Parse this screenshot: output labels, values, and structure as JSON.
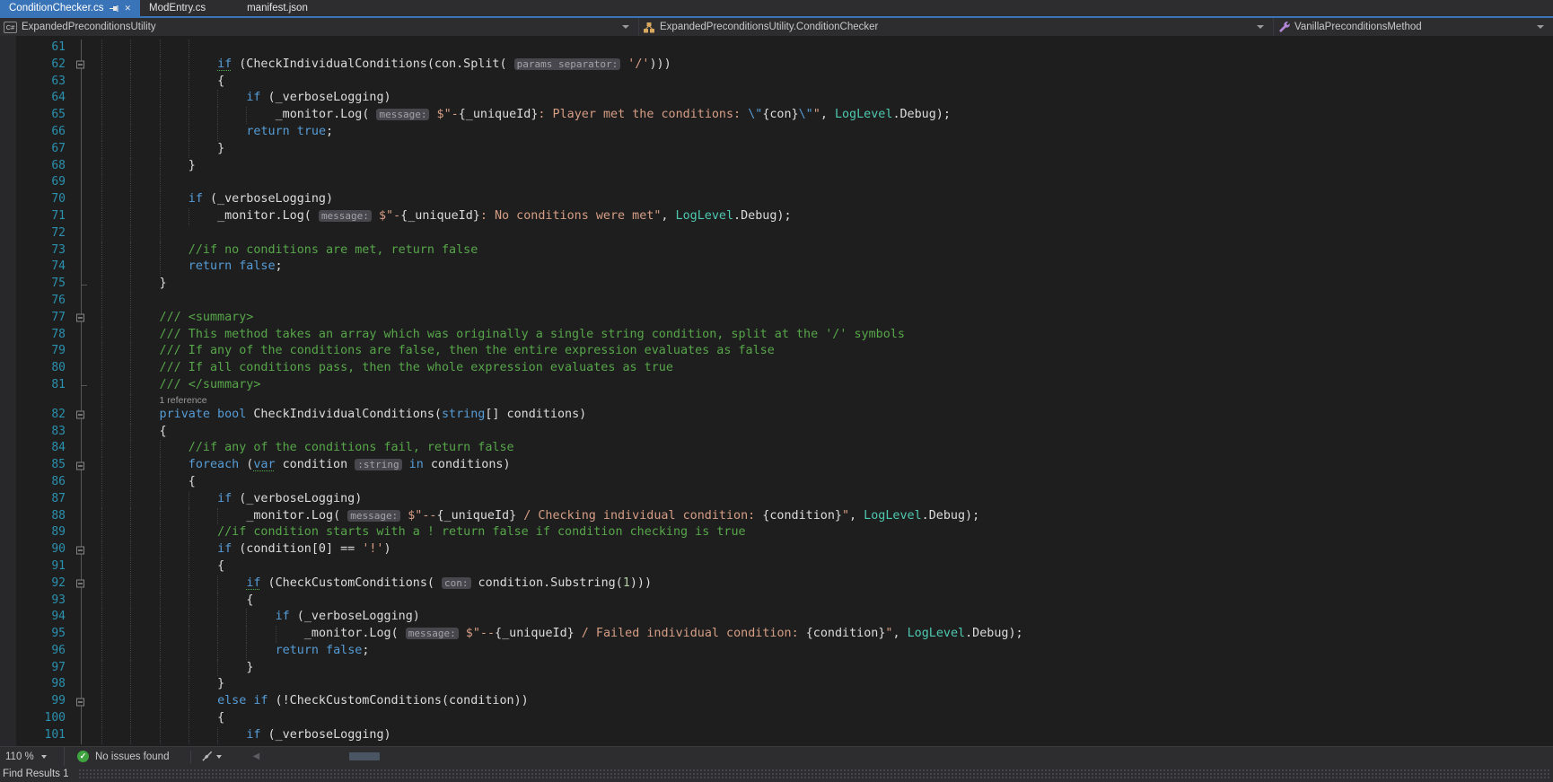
{
  "tabs": [
    {
      "label": "ConditionChecker.cs",
      "active": true
    },
    {
      "label": "ModEntry.cs",
      "active": false
    },
    {
      "label": "manifest.json",
      "active": false
    }
  ],
  "breadcrumb": {
    "project_scope": "ExpandedPreconditionsUtility",
    "type_scope": "ExpandedPreconditionsUtility.ConditionChecker",
    "member_scope": "VanillaPreconditionsMethod"
  },
  "status": {
    "zoom_level": "110 %",
    "issues_text": "No issues found"
  },
  "panel": {
    "title": "Find Results 1"
  },
  "colors": {
    "editor_background": "#1e1e1e",
    "chrome_background": "#2d2d30",
    "active_tab_blue": "#3973b8",
    "keyword_blue": "#569cd6",
    "string_orange": "#d69d85",
    "comment_green": "#57a64a",
    "type_teal": "#4ec9b0",
    "number_green": "#b5cea8",
    "line_number_blue": "#2b91af",
    "status_ok_green": "#3fa33f"
  },
  "editor": {
    "lines": [
      {
        "n": "61",
        "g": 4,
        "ol": "l",
        "seg": []
      },
      {
        "n": "62",
        "g": 4,
        "ol": "b",
        "seg": [
          [
            "kq",
            "if"
          ],
          [
            "p",
            " (CheckIndividualConditions(con.Split( "
          ],
          [
            "ch",
            "params separator:"
          ],
          [
            "s",
            " '/'"
          ],
          [
            "p",
            ")))"
          ]
        ]
      },
      {
        "n": "63",
        "g": 4,
        "ol": "l",
        "seg": [
          [
            "p",
            "{"
          ]
        ]
      },
      {
        "n": "64",
        "g": 5,
        "ol": "l",
        "seg": [
          [
            "k",
            "if"
          ],
          [
            "p",
            " (_verboseLogging)"
          ]
        ]
      },
      {
        "n": "65",
        "g": 6,
        "ol": "l",
        "seg": [
          [
            "p",
            "_monitor.Log( "
          ],
          [
            "ch",
            "message:"
          ],
          [
            "s",
            " $\"-"
          ],
          [
            "p",
            "{_uniqueId}"
          ],
          [
            "s",
            ": Player met the conditions: "
          ],
          [
            "e",
            "\\\""
          ],
          [
            "p",
            "{con}"
          ],
          [
            "e",
            "\\\""
          ],
          [
            "s",
            "\""
          ],
          [
            "p",
            ", "
          ],
          [
            "t",
            "LogLevel"
          ],
          [
            "p",
            ".Debug);"
          ]
        ]
      },
      {
        "n": "66",
        "g": 5,
        "ol": "l",
        "seg": [
          [
            "k",
            "return true"
          ],
          [
            "p",
            ";"
          ]
        ]
      },
      {
        "n": "67",
        "g": 4,
        "ol": "l",
        "seg": [
          [
            "p",
            "}"
          ]
        ]
      },
      {
        "n": "68",
        "g": 3,
        "ol": "l",
        "seg": [
          [
            "p",
            "}"
          ]
        ]
      },
      {
        "n": "69",
        "g": 3,
        "ol": "l",
        "seg": []
      },
      {
        "n": "70",
        "g": 3,
        "ol": "l",
        "seg": [
          [
            "k",
            "if"
          ],
          [
            "p",
            " (_verboseLogging)"
          ]
        ]
      },
      {
        "n": "71",
        "g": 4,
        "ol": "l",
        "seg": [
          [
            "p",
            "_monitor.Log( "
          ],
          [
            "ch",
            "message:"
          ],
          [
            "s",
            " $\"-"
          ],
          [
            "p",
            "{_uniqueId}"
          ],
          [
            "s",
            ": No conditions were met\""
          ],
          [
            "p",
            ", "
          ],
          [
            "t",
            "LogLevel"
          ],
          [
            "p",
            ".Debug);"
          ]
        ]
      },
      {
        "n": "72",
        "g": 3,
        "ol": "l",
        "seg": []
      },
      {
        "n": "73",
        "g": 3,
        "ol": "l",
        "seg": [
          [
            "c",
            "//if no conditions are met, return false"
          ]
        ]
      },
      {
        "n": "74",
        "g": 3,
        "ol": "l",
        "seg": [
          [
            "k",
            "return false"
          ],
          [
            "p",
            ";"
          ]
        ]
      },
      {
        "n": "75",
        "g": 2,
        "ol": "t",
        "seg": [
          [
            "p",
            "}"
          ]
        ]
      },
      {
        "n": "76",
        "g": 2,
        "ol": "l",
        "seg": []
      },
      {
        "n": "77",
        "g": 2,
        "ol": "b",
        "seg": [
          [
            "c",
            "/// <summary>"
          ]
        ]
      },
      {
        "n": "78",
        "g": 2,
        "ol": "l",
        "seg": [
          [
            "c",
            "/// This method takes an array which was originally a single string condition, split at the '/' symbols"
          ]
        ]
      },
      {
        "n": "79",
        "g": 2,
        "ol": "l",
        "seg": [
          [
            "c",
            "/// If any of the conditions are false, then the entire expression evaluates as false"
          ]
        ]
      },
      {
        "n": "80",
        "g": 2,
        "ol": "l",
        "seg": [
          [
            "c",
            "/// If all conditions pass, then the whole expression evaluates as true"
          ]
        ]
      },
      {
        "n": "81",
        "g": 2,
        "ol": "t",
        "seg": [
          [
            "c",
            "/// </summary>"
          ]
        ]
      },
      {
        "n": "",
        "g": 2,
        "ol": "l",
        "lens": "1 reference"
      },
      {
        "n": "82",
        "g": 2,
        "ol": "b",
        "seg": [
          [
            "k",
            "private bool"
          ],
          [
            "p",
            " CheckIndividualConditions("
          ],
          [
            "k",
            "string"
          ],
          [
            "p",
            "[] conditions)"
          ]
        ]
      },
      {
        "n": "83",
        "g": 2,
        "ol": "l",
        "seg": [
          [
            "p",
            "{"
          ]
        ]
      },
      {
        "n": "84",
        "g": 3,
        "ol": "l",
        "seg": [
          [
            "c",
            "//if any of the conditions fail, return false"
          ]
        ]
      },
      {
        "n": "85",
        "g": 3,
        "ol": "b",
        "seg": [
          [
            "k",
            "foreach"
          ],
          [
            "p",
            " ("
          ],
          [
            "kq",
            "var"
          ],
          [
            "p",
            " condition "
          ],
          [
            "ch",
            ":string"
          ],
          [
            "p",
            " "
          ],
          [
            "k",
            "in"
          ],
          [
            "p",
            " conditions)"
          ]
        ]
      },
      {
        "n": "86",
        "g": 3,
        "ol": "l",
        "seg": [
          [
            "p",
            "{"
          ]
        ]
      },
      {
        "n": "87",
        "g": 4,
        "ol": "l",
        "seg": [
          [
            "k",
            "if"
          ],
          [
            "p",
            " (_verboseLogging)"
          ]
        ]
      },
      {
        "n": "88",
        "g": 5,
        "ol": "l",
        "seg": [
          [
            "p",
            "_monitor.Log( "
          ],
          [
            "ch",
            "message:"
          ],
          [
            "s",
            " $\"--"
          ],
          [
            "p",
            "{_uniqueId}"
          ],
          [
            "s",
            " / Checking individual condition: "
          ],
          [
            "p",
            "{condition}"
          ],
          [
            "s",
            "\""
          ],
          [
            "p",
            ", "
          ],
          [
            "t",
            "LogLevel"
          ],
          [
            "p",
            ".Debug);"
          ]
        ]
      },
      {
        "n": "89",
        "g": 4,
        "ol": "l",
        "seg": [
          [
            "c",
            "//if condition starts with a ! return false if condition checking is true"
          ]
        ]
      },
      {
        "n": "90",
        "g": 4,
        "ol": "b",
        "seg": [
          [
            "k",
            "if"
          ],
          [
            "p",
            " (condition[0] == "
          ],
          [
            "s",
            "'!'"
          ],
          [
            "p",
            ")"
          ]
        ]
      },
      {
        "n": "91",
        "g": 4,
        "ol": "l",
        "seg": [
          [
            "p",
            "{"
          ]
        ]
      },
      {
        "n": "92",
        "g": 5,
        "ol": "b",
        "seg": [
          [
            "kq",
            "if"
          ],
          [
            "p",
            " (CheckCustomConditions( "
          ],
          [
            "ch",
            "con:"
          ],
          [
            "p",
            " condition.Substring("
          ],
          [
            "n2",
            "1"
          ],
          [
            "p",
            ")))"
          ]
        ]
      },
      {
        "n": "93",
        "g": 5,
        "ol": "l",
        "seg": [
          [
            "p",
            "{"
          ]
        ]
      },
      {
        "n": "94",
        "g": 6,
        "ol": "l",
        "seg": [
          [
            "k",
            "if"
          ],
          [
            "p",
            " (_verboseLogging)"
          ]
        ]
      },
      {
        "n": "95",
        "g": 7,
        "ol": "l",
        "seg": [
          [
            "p",
            "_monitor.Log( "
          ],
          [
            "ch",
            "message:"
          ],
          [
            "s",
            " $\"--"
          ],
          [
            "p",
            "{_uniqueId}"
          ],
          [
            "s",
            " / Failed individual condition: "
          ],
          [
            "p",
            "{condition}"
          ],
          [
            "s",
            "\""
          ],
          [
            "p",
            ", "
          ],
          [
            "t",
            "LogLevel"
          ],
          [
            "p",
            ".Debug);"
          ]
        ]
      },
      {
        "n": "96",
        "g": 6,
        "ol": "l",
        "seg": [
          [
            "k",
            "return false"
          ],
          [
            "p",
            ";"
          ]
        ]
      },
      {
        "n": "97",
        "g": 5,
        "ol": "l",
        "seg": [
          [
            "p",
            "}"
          ]
        ]
      },
      {
        "n": "98",
        "g": 4,
        "ol": "l",
        "seg": [
          [
            "p",
            "}"
          ]
        ]
      },
      {
        "n": "99",
        "g": 4,
        "ol": "b",
        "seg": [
          [
            "k",
            "else if"
          ],
          [
            "p",
            " (!CheckCustomConditions(condition))"
          ]
        ]
      },
      {
        "n": "100",
        "g": 4,
        "ol": "l",
        "seg": [
          [
            "p",
            "{"
          ]
        ]
      },
      {
        "n": "101",
        "g": 5,
        "ol": "l",
        "seg": [
          [
            "k",
            "if"
          ],
          [
            "p",
            " (_verboseLogging)"
          ]
        ]
      }
    ]
  }
}
